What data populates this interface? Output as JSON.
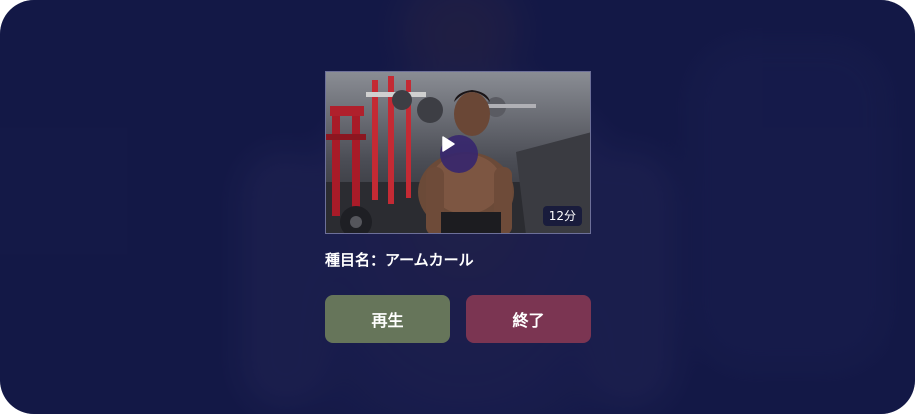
{
  "video": {
    "duration": "12分",
    "play_icon": "play-icon"
  },
  "exercise": {
    "label": "種目名：",
    "name": "アームカール"
  },
  "actions": {
    "play_label": "再生",
    "end_label": "終了"
  },
  "colors": {
    "background": "#151a48",
    "play_button": "#66755a",
    "end_button": "#7b3552",
    "play_overlay": "#36266e"
  }
}
